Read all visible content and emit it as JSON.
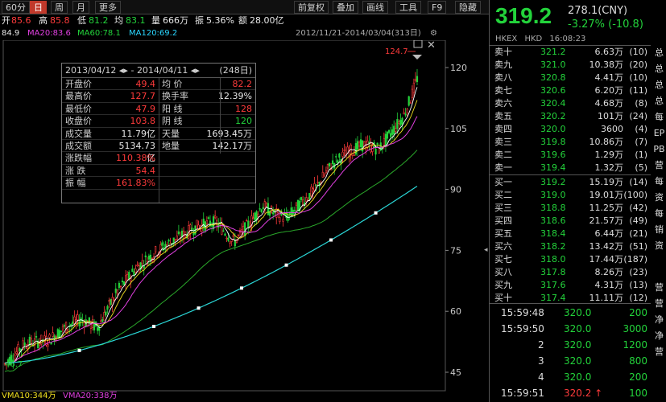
{
  "toolbar": {
    "left_items": [
      "60分",
      "日",
      "周",
      "月",
      "更多"
    ],
    "active_index": 1,
    "right_items": [
      "前复权",
      "叠加",
      "画线",
      "工具",
      "F9",
      "隐藏"
    ]
  },
  "stats": {
    "open_label": "开",
    "open_value": "85.6",
    "high_label": "高",
    "high_value": "85.8",
    "low_label": "低",
    "low_value": "81.2",
    "avg_label": "均",
    "avg_value": "83.1",
    "vol_label": "量",
    "vol_value": "666万",
    "amp_label": "振",
    "amp_value": "5.36%",
    "amount_label": "额",
    "amount_value": "28.00亿"
  },
  "ma": {
    "ma_first": "84.9",
    "ma20": "MA20:83.6",
    "ma60": "MA60:78.1",
    "ma120": "MA120:69.2",
    "range": "2012/11/21-2014/03/04(313日)"
  },
  "info_box": {
    "start": "2013/04/12",
    "end": "2014/04/11",
    "days": "(248日)",
    "sep": "-",
    "left_rows": [
      {
        "label": "开盘价",
        "value": "49.4",
        "color": "red"
      },
      {
        "label": "最高价",
        "value": "127.7",
        "color": "red"
      },
      {
        "label": "最低价",
        "value": "47.9",
        "color": "red"
      },
      {
        "label": "收盘价",
        "value": "103.8",
        "color": "red"
      },
      {
        "label": "成交量",
        "value": "11.79亿",
        "color": "white"
      },
      {
        "label": "成交额",
        "value": "5134.73亿",
        "color": "white"
      },
      {
        "label": "涨跌幅",
        "value": "110.38%",
        "color": "red"
      },
      {
        "label": "涨 跌",
        "value": "54.4",
        "color": "red"
      },
      {
        "label": "振 幅",
        "value": "161.83%",
        "color": "red"
      }
    ],
    "right_rows": [
      {
        "label": "均 价",
        "value": "82.2",
        "color": "red"
      },
      {
        "label": "换手率",
        "value": "12.39%",
        "color": "white"
      },
      {
        "label": "阳 线",
        "value": "128",
        "color": "red"
      },
      {
        "label": "阴 线",
        "value": "120",
        "color": "green"
      },
      {
        "label": "天量",
        "value": "1693.45万",
        "color": "white"
      },
      {
        "label": "地量",
        "value": "142.17万",
        "color": "white"
      }
    ]
  },
  "y_axis_labels": [
    "120",
    "105",
    "90",
    "75",
    "60",
    "45"
  ],
  "peak_label": "124.7",
  "low_label_chart": "46.7",
  "bottom": {
    "vma10": "VMA10:344万",
    "vma20": "VMA20:338万"
  },
  "quote": {
    "price": "319.2",
    "prev_close": "278.1(CNY)",
    "change": "-3.27% (-10.8)",
    "exchange": "HKEX",
    "currency": "HKD",
    "time": "16:08:23"
  },
  "sell_orders": [
    {
      "label": "卖十",
      "price": "321.2",
      "vol": "6.63万",
      "cnt": "10"
    },
    {
      "label": "卖九",
      "price": "321.0",
      "vol": "10.38万",
      "cnt": "20"
    },
    {
      "label": "卖八",
      "price": "320.8",
      "vol": "4.41万",
      "cnt": "10"
    },
    {
      "label": "卖七",
      "price": "320.6",
      "vol": "6.20万",
      "cnt": "11"
    },
    {
      "label": "卖六",
      "price": "320.4",
      "vol": "4.68万",
      "cnt": "8"
    },
    {
      "label": "卖五",
      "price": "320.2",
      "vol": "101万",
      "cnt": "24"
    },
    {
      "label": "卖四",
      "price": "320.0",
      "vol": "3600",
      "cnt": "4"
    },
    {
      "label": "卖三",
      "price": "319.8",
      "vol": "10.86万",
      "cnt": "7"
    },
    {
      "label": "卖二",
      "price": "319.6",
      "vol": "1.29万",
      "cnt": "1"
    },
    {
      "label": "卖一",
      "price": "319.4",
      "vol": "1.32万",
      "cnt": "5"
    }
  ],
  "buy_orders": [
    {
      "label": "买一",
      "price": "319.2",
      "vol": "15.19万",
      "cnt": "14"
    },
    {
      "label": "买二",
      "price": "319.0",
      "vol": "19.01万",
      "cnt": "100"
    },
    {
      "label": "买三",
      "price": "318.8",
      "vol": "11.25万",
      "cnt": "42"
    },
    {
      "label": "买四",
      "price": "318.6",
      "vol": "21.57万",
      "cnt": "49"
    },
    {
      "label": "买五",
      "price": "318.4",
      "vol": "6.44万",
      "cnt": "21"
    },
    {
      "label": "买六",
      "price": "318.2",
      "vol": "13.42万",
      "cnt": "51"
    },
    {
      "label": "买七",
      "price": "318.0",
      "vol": "17.44万",
      "cnt": "187"
    },
    {
      "label": "买八",
      "price": "317.8",
      "vol": "8.26万",
      "cnt": "23"
    },
    {
      "label": "买九",
      "price": "317.6",
      "vol": "4.31万",
      "cnt": "13"
    },
    {
      "label": "买十",
      "price": "317.4",
      "vol": "11.11万",
      "cnt": "12"
    }
  ],
  "side_tabs": [
    "总",
    "总",
    "总",
    "总",
    "每",
    "EP",
    "PB",
    "营",
    "每",
    "资",
    "每",
    "销",
    "资"
  ],
  "side_tabs_bottom": [
    "营",
    "营",
    "净",
    "净",
    "营"
  ],
  "ticks": [
    {
      "time": "15:59:48",
      "price": "320.0",
      "vol": "200"
    },
    {
      "time": "15:59:50",
      "price": "320.0",
      "vol": "3000"
    },
    {
      "time": "2",
      "price": "320.0",
      "vol": "1200"
    },
    {
      "time": "3",
      "price": "320.0",
      "vol": "800"
    },
    {
      "time": "4",
      "price": "320.0",
      "vol": "200"
    },
    {
      "time": "15:59:51",
      "price": "320.2 ↑",
      "vol": "100"
    }
  ],
  "colors": {
    "up": "#ff3b3b",
    "down": "#23d33b",
    "ma5": "#ffffff",
    "ma10": "#f0e020",
    "ma20": "#e040e0",
    "ma60": "#2aa82a",
    "ma120": "#2ad6d6"
  }
}
